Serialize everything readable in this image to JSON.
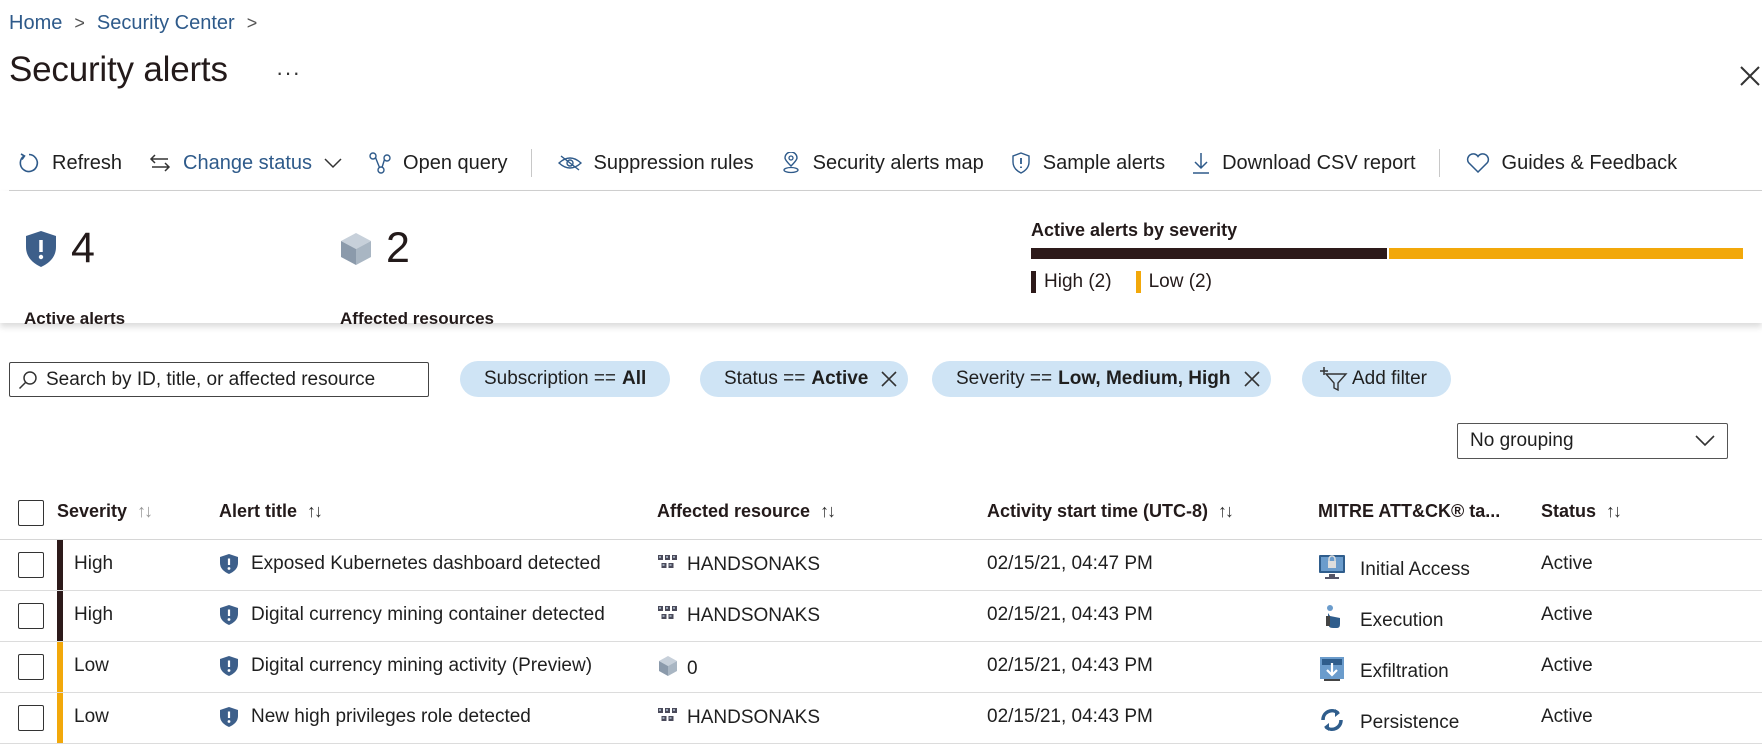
{
  "breadcrumb": {
    "home": "Home",
    "security_center": "Security Center"
  },
  "page": {
    "title": "Security alerts",
    "more": "···"
  },
  "toolbar": {
    "refresh": "Refresh",
    "change_status": "Change status",
    "open_query": "Open query",
    "suppression_rules": "Suppression rules",
    "security_alerts_map": "Security alerts map",
    "sample_alerts": "Sample alerts",
    "download_csv": "Download CSV report",
    "guides_feedback": "Guides & Feedback"
  },
  "summary": {
    "active_alerts_count": "4",
    "active_alerts_label": "Active alerts",
    "affected_resources_count": "2",
    "affected_resources_label": "Affected resources",
    "severity_title": "Active alerts by severity",
    "high_legend": "High (2)",
    "low_legend": "Low (2)",
    "high_share": 0.5,
    "low_share": 0.5
  },
  "filters": {
    "search_placeholder": "Search by ID, title, or affected resource",
    "subscription_key": "Subscription ==",
    "subscription_value": "All",
    "status_key": "Status ==",
    "status_value": "Active",
    "severity_key": "Severity ==",
    "severity_value": "Low, Medium, High",
    "add_filter": "Add filter"
  },
  "grouping": {
    "selected": "No grouping"
  },
  "table": {
    "columns": {
      "severity": "Severity",
      "alert_title": "Alert title",
      "affected_resource": "Affected resource",
      "activity_start": "Activity start time (UTC-8)",
      "mitre": "MITRE ATT&CK® ta...",
      "status": "Status",
      "sort_glyph": "↑↓"
    },
    "rows": [
      {
        "severity": "High",
        "title": "Exposed Kubernetes dashboard detected",
        "resource": "HANDSONAKS",
        "time": "02/15/21, 04:47 PM",
        "tactic": "Initial Access",
        "status": "Active"
      },
      {
        "severity": "High",
        "title": "Digital currency mining container detected",
        "resource": "HANDSONAKS",
        "time": "02/15/21, 04:43 PM",
        "tactic": "Execution",
        "status": "Active"
      },
      {
        "severity": "Low",
        "title": "Digital currency mining activity (Preview)",
        "resource": "0",
        "time": "02/15/21, 04:43 PM",
        "tactic": "Exfiltration",
        "status": "Active"
      },
      {
        "severity": "Low",
        "title": "New high privileges role detected",
        "resource": "HANDSONAKS",
        "time": "02/15/21, 04:43 PM",
        "tactic": "Persistence",
        "status": "Active"
      }
    ]
  },
  "colors": {
    "high": "#2d1a1a",
    "low": "#f2a80a",
    "pill": "#cfe4f5",
    "link": "#2e5a8a"
  }
}
